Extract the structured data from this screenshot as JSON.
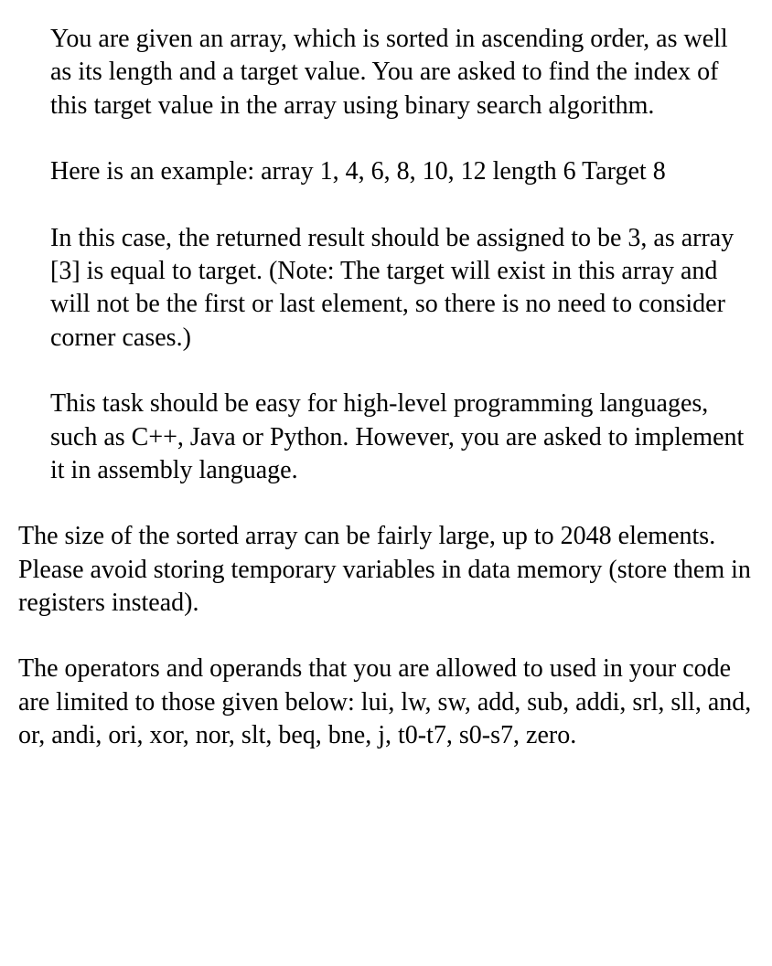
{
  "paragraphs": {
    "p1": "You are given an array, which is sorted in ascending order, as well as its length and a target value. You are asked to find the index of this target value in the array using binary search algorithm.",
    "p2": "Here is an example: array 1, 4, 6, 8, 10, 12 length 6 Target 8",
    "p3": "In this case, the returned result should be assigned to be 3, as array [3] is equal to target. (Note: The target will exist in this array and will not be the first or last element, so there is no need to consider corner cases.)",
    "p4": "This task should be easy for high-level programming languages, such as C++, Java or Python. However, you are asked to implement it in assembly language.",
    "p5": "The size of the sorted array can be fairly large, up to 2048 elements. Please avoid storing temporary variables in data memory (store them in registers instead).",
    "p6": " The operators and operands that you are allowed to used in your code are limited to those given below: lui, lw, sw, add, sub, addi, srl, sll, and, or, andi, ori, xor, nor, slt, beq, bne, j, t0-t7, s0-s7, zero."
  }
}
